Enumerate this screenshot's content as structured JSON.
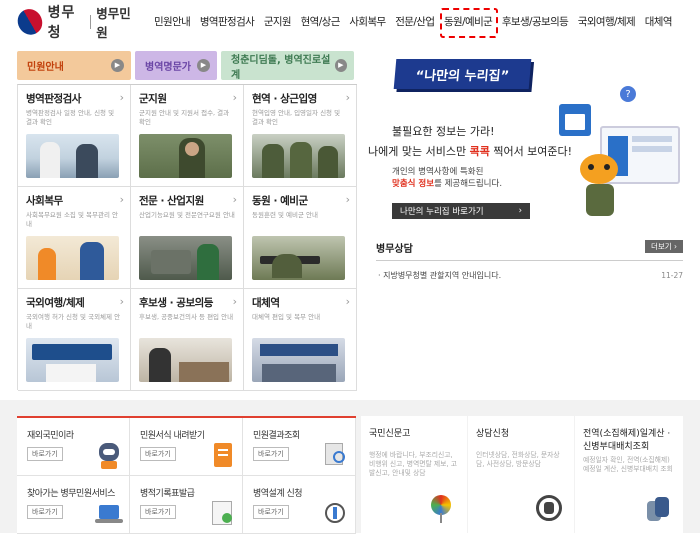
{
  "header": {
    "logo_name": "병무청",
    "logo_sub": "병무민원",
    "menu": [
      "민원안내",
      "병역판정검사",
      "군지원",
      "현역/상근",
      "사회복무",
      "전문/산업",
      "동원/예비군",
      "후보생/공보의등",
      "국외여행/체제",
      "대체역"
    ],
    "highlighted_item": "동원/예비군"
  },
  "banners": [
    {
      "label": "민원안내",
      "color": "#f3c99b",
      "text_color": "#c2410c"
    },
    {
      "label": "병역명문가",
      "color": "#cdb7e6",
      "text_color": "#6b46a6"
    },
    {
      "label": "청춘디딤돌, 병역진로설계",
      "color": "#c9e3cf",
      "text_color": "#3e7a52"
    }
  ],
  "grid": [
    {
      "title": "병역판정검사",
      "desc": "병역판정검사 일정 안내, 신청 및 결과 확인",
      "scene": "medical"
    },
    {
      "title": "군지원",
      "desc": "군지원 안내 및 지원서 접수, 결과 확인",
      "scene": "army"
    },
    {
      "title": "현역 · 상근입영",
      "desc": "현역입영 안내, 입영일자 신청 및 결과 확인",
      "scene": "soldiers"
    },
    {
      "title": "사회복무",
      "desc": "사회복무요원 소집 및 복무관리 안내",
      "scene": "care"
    },
    {
      "title": "전문 · 산업지원",
      "desc": "산업기능요원 및 전문연구요원 안내",
      "scene": "factory"
    },
    {
      "title": "동원 · 예비군",
      "desc": "동원훈련 및 예비군 안내",
      "scene": "training"
    },
    {
      "title": "국외여행/체제",
      "desc": "국외여행 허가 신청 및 국외체제 안내",
      "scene": "office"
    },
    {
      "title": "후보생 · 공보의등",
      "desc": "후보생, 공중보건의사 등 편입 안내",
      "scene": "counter"
    },
    {
      "title": "대체역",
      "desc": "대체역 편입 및 복무 안내",
      "scene": "hall"
    }
  ],
  "promo": {
    "title": "“나만의 누리집”",
    "line1": "불필요한 정보는 가라!",
    "line2_pre": "나에게 맞는 서비스만 ",
    "line2_em": "콕콕",
    "line2_post": " 찍어서 보여준다!",
    "line3": "개인의 병역사항에 특화된",
    "line4_em": "맞춤식 정보",
    "line4_post": "를 제공해드립니다.",
    "button": "나만의 누리집 바로가기",
    "question": "?"
  },
  "counsel": {
    "title": "병무상담",
    "more": "더보기",
    "item": "지방병무청별 관할지역 안내입니다.",
    "date": "11-27"
  },
  "services": [
    {
      "title": "재외국민이라",
      "btn": "바로가기",
      "icon": "robot-icon"
    },
    {
      "title": "민원서식 내려받기",
      "btn": "바로가기",
      "icon": "document-icon"
    },
    {
      "title": "민원결과조회",
      "btn": "바로가기",
      "icon": "search-doc-icon"
    },
    {
      "title": "찾아가는 병무민원서비스",
      "btn": "바로가기",
      "icon": "laptop-icon"
    },
    {
      "title": "병적기록표발급",
      "btn": "바로가기",
      "icon": "certificate-icon"
    },
    {
      "title": "병역설계 신청",
      "btn": "바로가기",
      "icon": "compass-icon"
    }
  ],
  "info": [
    {
      "title": "국민신문고",
      "desc": "행정에 바랍니다, 부조리신고, 비행위 신고, 병역면탈 제보, 고발신고, 안내및 상담",
      "icon": "lollipop-icon"
    },
    {
      "title": "상담신청",
      "desc": "인터넷상담, 전화상담, 문자상담, 사전상담, 방문상담",
      "icon": "phone-icon"
    },
    {
      "title": "전역(소집해제)일계산 · 신병부대배치조회",
      "desc": "예정일자 확인, 전역(소집해제) 예정일 계산, 신병부대배치 조회",
      "icon": "dogtag-icon"
    }
  ]
}
